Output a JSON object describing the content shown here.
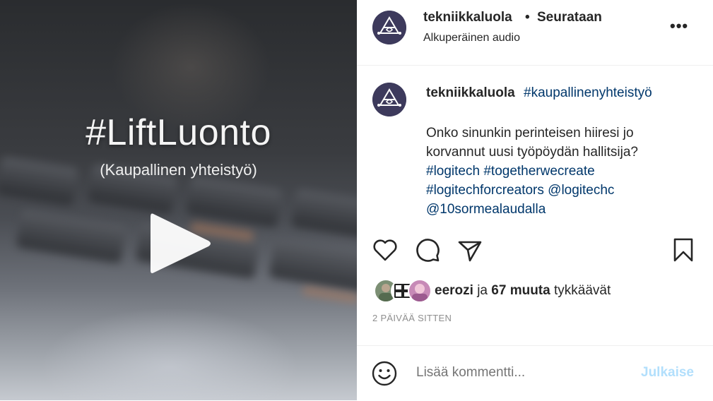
{
  "media": {
    "title": "#LiftLuonto",
    "subtitle": "(Kaupallinen yhteistyö)",
    "play_icon": "play-icon"
  },
  "header": {
    "username": "tekniikkaluola",
    "separator": "•",
    "follow_status": "Seurataan",
    "audio": "Alkuperäinen audio",
    "more": "•••"
  },
  "caption": {
    "username": "tekniikkaluola",
    "hashtag": "#kaupallinenyhteistyö",
    "line1": "Onko sinunkin perinteisen hiiresi jo",
    "line2": "korvannut uusi työpöydän hallitsija?",
    "links": [
      "#logitech",
      "#togetherwecreate",
      "#logitechforcreators",
      "@logitechc",
      "@10sormealaudalla"
    ]
  },
  "actions": {
    "icons": [
      "heart-icon",
      "comment-icon",
      "share-icon",
      "bookmark-icon"
    ]
  },
  "likes": {
    "user": "eerozi",
    "connector": "ja",
    "others": "67 muuta",
    "suffix": "tykkäävät"
  },
  "timestamp": "2 PÄIVÄÄ SITTEN",
  "comment": {
    "placeholder": "Lisää kommentti...",
    "post_label": "Julkaise"
  },
  "colors": {
    "link": "#00376b",
    "muted": "#8e8e8e",
    "post_disabled": "#b2dffc",
    "avatar_bg": "#3d3a5c"
  }
}
